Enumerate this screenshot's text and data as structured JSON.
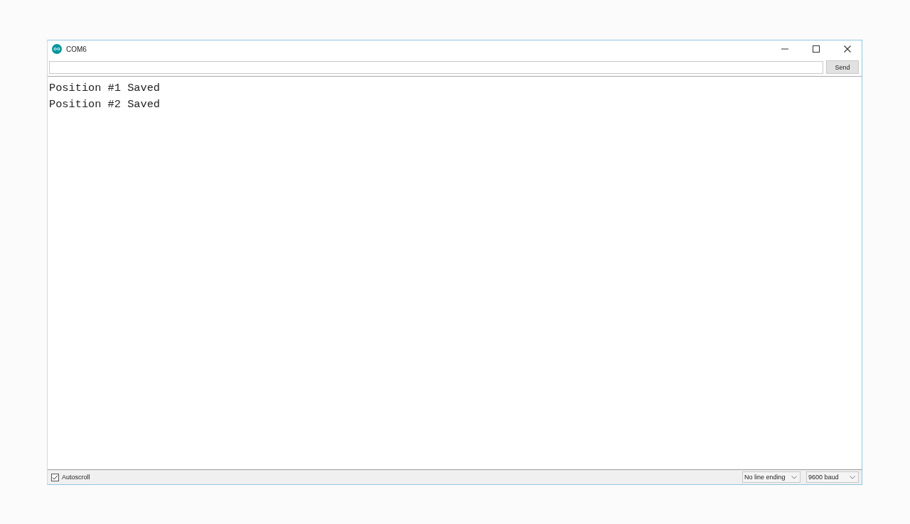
{
  "window": {
    "title": "COM6"
  },
  "send_button": {
    "label": "Send"
  },
  "output_lines": [
    "Position #1 Saved",
    "Position #2 Saved"
  ],
  "status_bar": {
    "autoscroll": {
      "label": "Autoscroll",
      "checked": true
    },
    "line_ending": {
      "value": "No line ending"
    },
    "baud_rate": {
      "value": "9600 baud"
    }
  }
}
